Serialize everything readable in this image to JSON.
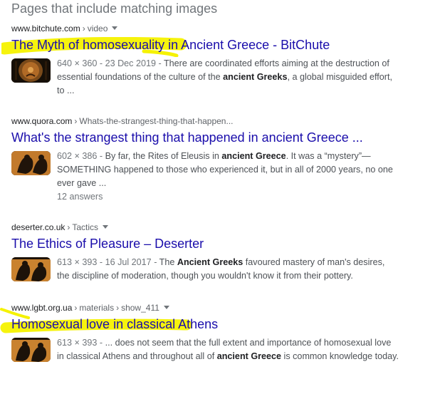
{
  "heading": "Pages that include matching images",
  "results": [
    {
      "domain": "www.bitchute.com",
      "path": [
        "video"
      ],
      "title": "The Myth of homosexuality in Ancient Greece - BitChute",
      "meta": "640 × 360 - 23 Dec 2019 -",
      "snippet": [
        {
          "t": " There are coordinated efforts aiming at the destruction of essential foundations of the culture of the "
        },
        {
          "b": "ancient Greeks"
        },
        {
          "t": ", a global misguided effort, to ..."
        }
      ],
      "thumb_icon": "greek-pottery-thumbnail"
    },
    {
      "domain": "www.quora.com",
      "path": [
        "Whats-the-strangest-thing-that-happen..."
      ],
      "title": "What's the strangest thing that happened in ancient Greece ...",
      "meta": "602 × 386 -",
      "snippet": [
        {
          "t": " By far, the Rites of Eleusis in "
        },
        {
          "b": "ancient Greece"
        },
        {
          "t": ". It was a “mystery”— SOMETHING happened to those who experienced it, but in all of 2000 years, no one ever gave ..."
        }
      ],
      "answers": "12 answers",
      "thumb_icon": "greek-pottery-thumbnail"
    },
    {
      "domain": "deserter.co.uk",
      "path": [
        "Tactics"
      ],
      "title": "The Ethics of Pleasure – Deserter",
      "meta": "613 × 393 - 16 Jul 2017 -",
      "snippet": [
        {
          "t": " The "
        },
        {
          "b": "Ancient Greeks"
        },
        {
          "t": " favoured mastery of man's desires, the discipline of moderation, though you wouldn't know it from their pottery."
        }
      ],
      "thumb_icon": "greek-pottery-thumbnail"
    },
    {
      "domain": "www.lgbt.org.ua",
      "path": [
        "materials",
        "show_411"
      ],
      "title": "Homosexual love in classical Athens",
      "meta": "613 × 393 -",
      "snippet": [
        {
          "t": " ... does not seem that the full extent and importance of homosexual love in classical Athens and throughout all of "
        },
        {
          "b": "ancient Greece"
        },
        {
          "t": " is common knowledge today."
        }
      ],
      "thumb_icon": "greek-pottery-thumbnail"
    }
  ],
  "colors": {
    "link": "#1a0dab",
    "highlighter": "#f5f200",
    "meta": "#70757a",
    "snippet": "#4d5156"
  }
}
